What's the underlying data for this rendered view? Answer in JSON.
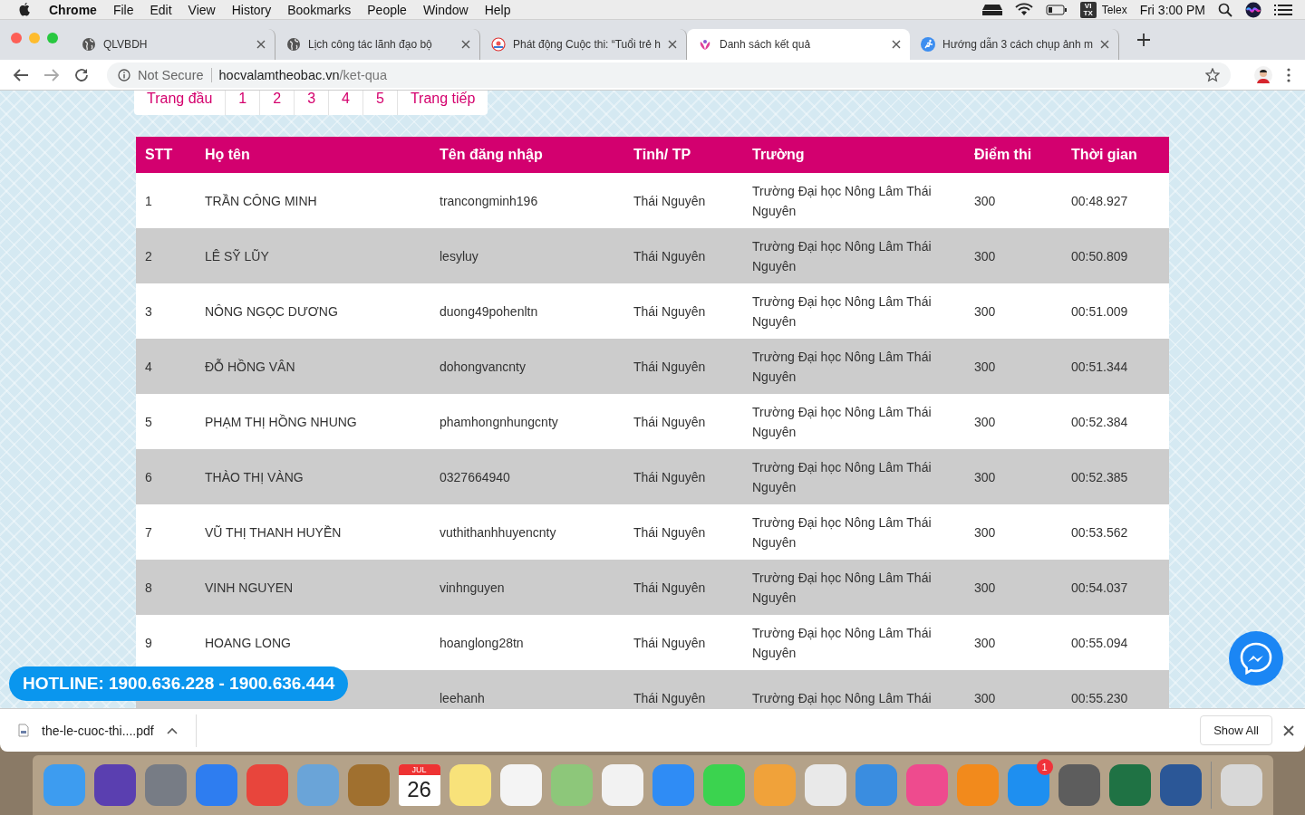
{
  "menubar": {
    "app": "Chrome",
    "menus": [
      "File",
      "Edit",
      "View",
      "History",
      "Bookmarks",
      "People",
      "Window",
      "Help"
    ],
    "input_icon": [
      "VI",
      "TX"
    ],
    "input_source": "Telex",
    "clock": "Fri 3:00 PM"
  },
  "tabs": [
    {
      "title": "QLVBDH",
      "selected": false
    },
    {
      "title": "Lịch công tác lãnh đạo bộ",
      "selected": false
    },
    {
      "title": "Phát động Cuộc thi: “Tuổi trẻ h",
      "selected": false
    },
    {
      "title": "Danh sách kết quả",
      "selected": true
    },
    {
      "title": "Hướng dẫn 3 cách chụp ảnh m",
      "selected": false
    }
  ],
  "address_bar": {
    "security": "Not Secure",
    "domain": "hocvalamtheobac.vn",
    "path": "/ket-qua"
  },
  "pagination": [
    "Trang đầu",
    "1",
    "2",
    "3",
    "4",
    "5",
    "Trang tiếp"
  ],
  "table": {
    "columns": [
      "STT",
      "Họ tên",
      "Tên đăng nhập",
      "Tỉnh/ TP",
      "Trường",
      "Điểm thi",
      "Thời gian"
    ],
    "rows": [
      {
        "stt": "1",
        "name": "TRẦN CÔNG MINH",
        "username": "trancongminh196",
        "province": "Thái Nguyên",
        "school": "Trường Đại học Nông Lâm Thái Nguyên",
        "score": "300",
        "time": "00:48.927"
      },
      {
        "stt": "2",
        "name": "LÊ SỸ LŨY",
        "username": "lesyluy",
        "province": "Thái Nguyên",
        "school": "Trường Đại học Nông Lâm Thái Nguyên",
        "score": "300",
        "time": "00:50.809"
      },
      {
        "stt": "3",
        "name": "NÔNG NGỌC DƯƠNG",
        "username": "duong49pohenltn",
        "province": "Thái Nguyên",
        "school": "Trường Đại học Nông Lâm Thái Nguyên",
        "score": "300",
        "time": "00:51.009"
      },
      {
        "stt": "4",
        "name": "ĐỖ HỒNG VÂN",
        "username": "dohongvancnty",
        "province": "Thái Nguyên",
        "school": "Trường Đại học Nông Lâm Thái Nguyên",
        "score": "300",
        "time": "00:51.344"
      },
      {
        "stt": "5",
        "name": "PHẠM THỊ HỒNG NHUNG",
        "username": "phamhongnhungcnty",
        "province": "Thái Nguyên",
        "school": "Trường Đại học Nông Lâm Thái Nguyên",
        "score": "300",
        "time": "00:52.384"
      },
      {
        "stt": "6",
        "name": "THÀO THỊ VÀNG",
        "username": "0327664940",
        "province": "Thái Nguyên",
        "school": "Trường Đại học Nông Lâm Thái Nguyên",
        "score": "300",
        "time": "00:52.385"
      },
      {
        "stt": "7",
        "name": "VŨ THỊ THANH HUYỀN",
        "username": "vuthithanhhuyencnty",
        "province": "Thái Nguyên",
        "school": "Trường Đại học Nông Lâm Thái Nguyên",
        "score": "300",
        "time": "00:53.562"
      },
      {
        "stt": "8",
        "name": "VINH NGUYEN",
        "username": "vinhnguyen",
        "province": "Thái Nguyên",
        "school": "Trường Đại học Nông Lâm Thái Nguyên",
        "score": "300",
        "time": "00:54.037"
      },
      {
        "stt": "9",
        "name": "HOANG LONG",
        "username": "hoanglong28tn",
        "province": "Thái Nguyên",
        "school": "Trường Đại học Nông Lâm Thái Nguyên",
        "score": "300",
        "time": "00:55.094"
      },
      {
        "username": "leehanh",
        "province": "Thái Nguyên",
        "school": "Trường Đại học Nông Lâm Thái",
        "score": "300",
        "time": "00:55.230"
      }
    ]
  },
  "hotline": "HOTLINE: 1900.636.228 - 1900.636.444",
  "download_bar": {
    "file": "the-le-cuoc-thi....pdf",
    "show_all": "Show All"
  },
  "dock": [
    {
      "kind": "app",
      "color": "#3d9cf0"
    },
    {
      "kind": "app",
      "color": "#5a3fb0"
    },
    {
      "kind": "app",
      "color": "#777c85"
    },
    {
      "kind": "app",
      "color": "#2e7df0"
    },
    {
      "kind": "app",
      "color": "#e8453c"
    },
    {
      "kind": "app",
      "color": "#6aa4d8"
    },
    {
      "kind": "app",
      "color": "#a0702f"
    },
    {
      "kind": "calendar",
      "color": "#ffffff",
      "month": "JUL",
      "day": "26"
    },
    {
      "kind": "app",
      "color": "#f8e27a"
    },
    {
      "kind": "app",
      "color": "#f4f4f4"
    },
    {
      "kind": "app",
      "color": "#8dc77a"
    },
    {
      "kind": "app",
      "color": "#f2f2f2"
    },
    {
      "kind": "app",
      "color": "#2f8cf5"
    },
    {
      "kind": "app",
      "color": "#3bd34f"
    },
    {
      "kind": "app",
      "color": "#f0a23a"
    },
    {
      "kind": "app",
      "color": "#e9e9e9"
    },
    {
      "kind": "app",
      "color": "#3a8de0"
    },
    {
      "kind": "app",
      "color": "#ee4b8e"
    },
    {
      "kind": "app",
      "color": "#f28a1c"
    },
    {
      "kind": "app",
      "color": "#1e8ff0",
      "badge": "1"
    },
    {
      "kind": "app",
      "color": "#5d5d5d"
    },
    {
      "kind": "app",
      "color": "#1f7244"
    },
    {
      "kind": "app",
      "color": "#2b5797"
    },
    {
      "kind": "separator"
    },
    {
      "kind": "app",
      "color": "#d8d8d8"
    }
  ]
}
